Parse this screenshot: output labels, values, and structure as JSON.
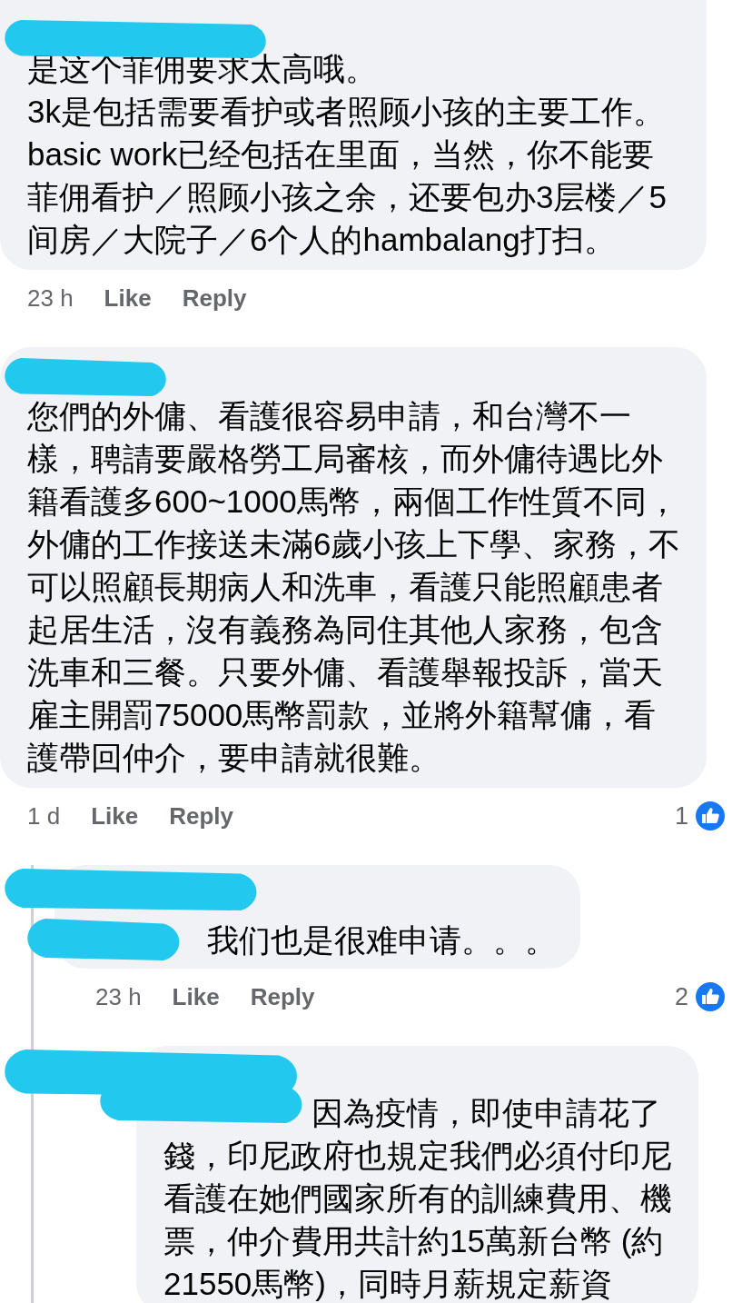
{
  "comments": [
    {
      "author_hidden": true,
      "text": "是这个菲佣要求太高哦。\n3k是包括需要看护或者照顾小孩的主要工作。basic work已经包括在里面，当然，你不能要菲佣看护／照顾小孩之余，还要包办3层楼／5间房／大院子／6个人的hambalang打扫。",
      "time": "23 h",
      "actions": [
        "Like",
        "Reply"
      ]
    },
    {
      "author_hidden": true,
      "text": "您們的外傭、看護很容易申請，和台灣不一樣，聘請要嚴格勞工局審核，而外傭待遇比外籍看護多600~1000馬幣，兩個工作性質不同，外傭的工作接送未滿6歲小孩上下學、家務，不可以照顧長期病人和洗車，看護只能照顧患者起居生活，沒有義務為同住其他人家務，包含洗車和三餐。只要外傭、看護舉報投訴，當天雇主開罰75000馬幣罰款，並將外籍幫傭，看護帶回仲介，要申請就很難。",
      "time": "1 d",
      "actions": [
        "Like",
        "Reply"
      ],
      "reactions": "1",
      "replies": [
        {
          "author_hidden": true,
          "mention_hidden": true,
          "text": "我们也是很难申请。。。",
          "time": "23 h",
          "actions": [
            "Like",
            "Reply"
          ],
          "reactions": "2",
          "replies": [
            {
              "author_hidden": true,
              "mention_hidden": true,
              "text": "因為疫情，即使申請花了錢，印尼政府也規定我們必須付印尼看護在她們國家所有的訓練費用、機票，仲介費用共計約15萬新台幣 (約21550馬幣)，同時月薪規定薪資"
            }
          ]
        }
      ]
    }
  ]
}
